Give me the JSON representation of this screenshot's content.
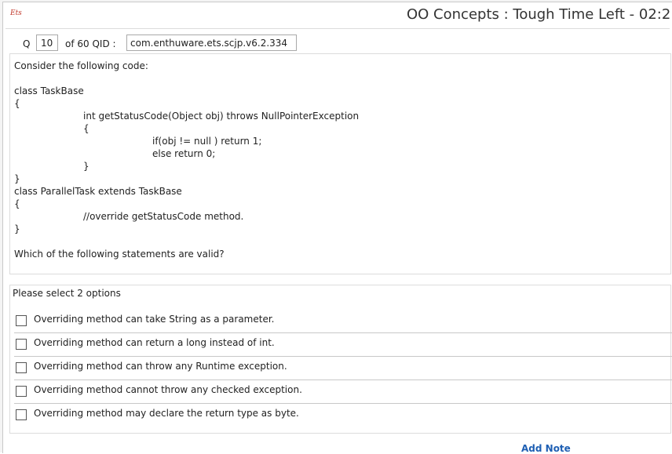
{
  "header": {
    "logo": "Ets",
    "title": "OO Concepts  :  Tough    Time Left - 02:2"
  },
  "question_bar": {
    "q_label": "Q",
    "q_number": "10",
    "of_label": "of 60  QID :",
    "qid": "com.enthuware.ets.scjp.v6.2.334"
  },
  "question": {
    "lines": [
      "Consider the following code:",
      "",
      "class TaskBase",
      "{",
      "int getStatusCode(Object obj) throws NullPointerException",
      "{",
      "if(obj != null ) return 1;",
      "else return 0;",
      "}",
      "}",
      "class ParallelTask extends TaskBase",
      "{",
      "//override getStatusCode method.",
      "}",
      "",
      "Which of the following statements are valid?"
    ]
  },
  "options": {
    "prompt": "Please select 2 options",
    "items": [
      {
        "label": "Overriding method can take String as a parameter.",
        "checked": false
      },
      {
        "label": "Overriding method can return a long instead of int.",
        "checked": false
      },
      {
        "label": "Overriding method can throw any Runtime exception.",
        "checked": false
      },
      {
        "label": "Overriding method cannot throw any checked exception.",
        "checked": false
      },
      {
        "label": "Overriding method may declare the return type as byte.",
        "checked": false
      }
    ]
  },
  "footer": {
    "add_note": "Add Note"
  }
}
